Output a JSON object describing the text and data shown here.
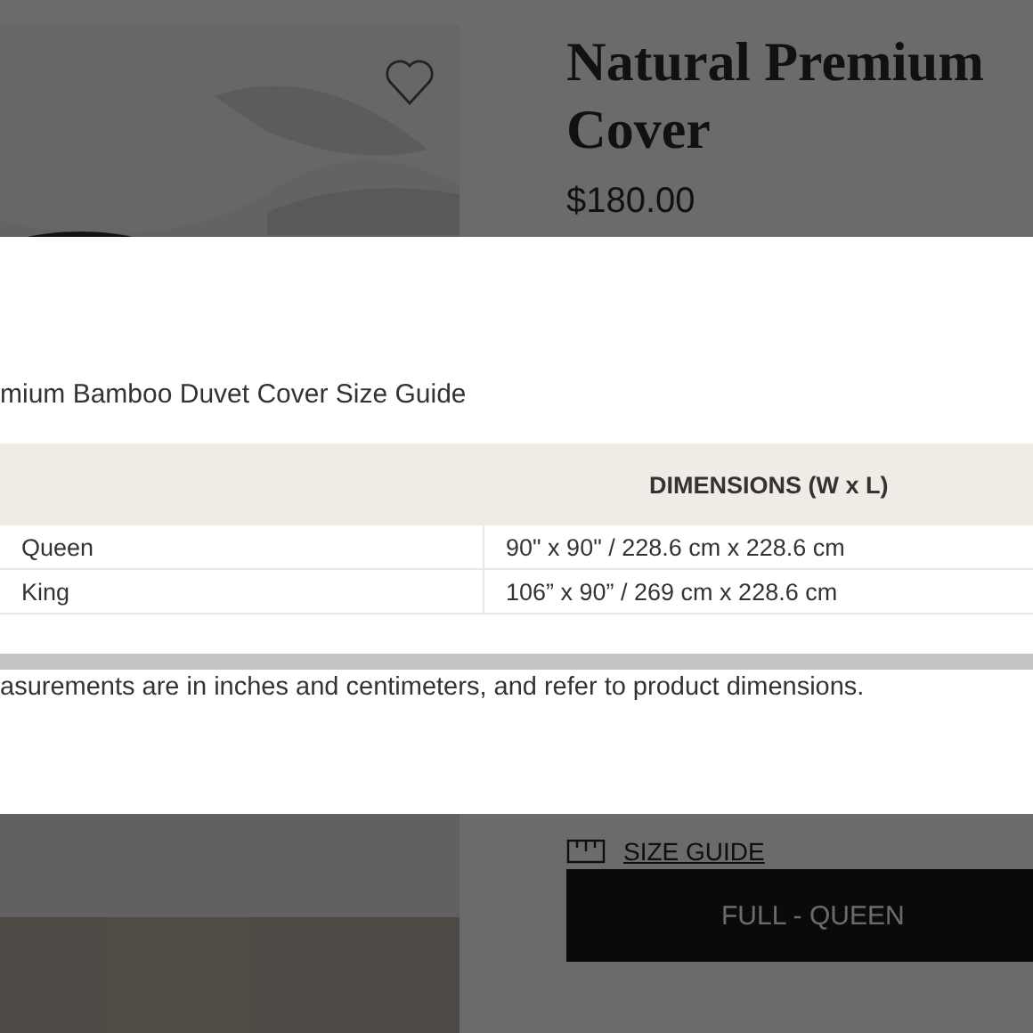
{
  "product": {
    "title": "Natural Premium Cover",
    "price": "$180.00",
    "size_guide_link": "SIZE GUIDE",
    "size_button": "FULL - QUEEN"
  },
  "modal": {
    "title": "mium Bamboo Duvet Cover Size Guide",
    "table": {
      "columns": [
        "",
        "DIMENSIONS (W x L)"
      ],
      "rows": [
        [
          "Queen",
          "90\" x 90\" / 228.6 cm x 228.6 cm"
        ],
        [
          "King",
          "106” x 90” / 269 cm x 228.6 cm"
        ]
      ]
    },
    "note": "asurements are in inches and centimeters, and refer to product dimensions."
  }
}
